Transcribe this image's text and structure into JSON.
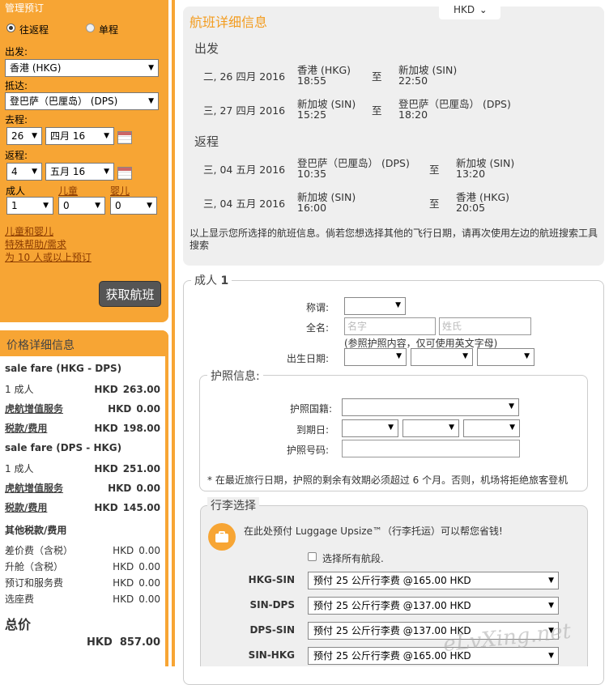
{
  "booking": {
    "header": "管理预订",
    "trip_roundtrip": "往返程",
    "trip_oneway": "单程",
    "from_label": "出发:",
    "from_value": "香港 (HKG)",
    "to_label": "抵达:",
    "to_value": "登巴萨（巴厘岛） (DPS)",
    "depart_label": "去程:",
    "depart_day": "26",
    "depart_month": "四月 16",
    "return_label": "返程:",
    "return_day": "4",
    "return_month": "五月 16",
    "adult_label": "成人",
    "child_label": "儿童",
    "infant_label": "婴儿",
    "adult_value": "1",
    "child_value": "0",
    "infant_value": "0",
    "links": [
      "儿童和婴儿",
      "特殊帮助/需求",
      "为 10 人或以上预订"
    ],
    "submit": "获取航班"
  },
  "price": {
    "header": "价格详细信息",
    "sections": [
      {
        "title": "sale fare (HKG - DPS)",
        "rows": [
          {
            "label": "1 成人",
            "currency": "HKD",
            "amount": "263.00",
            "link": false
          },
          {
            "label": "虎航增值服务",
            "currency": "HKD",
            "amount": "0.00",
            "link": true
          },
          {
            "label": "税款/费用",
            "currency": "HKD",
            "amount": "198.00",
            "link": true
          }
        ]
      },
      {
        "title": "sale fare (DPS - HKG)",
        "rows": [
          {
            "label": "1 成人",
            "currency": "HKD",
            "amount": "251.00",
            "link": false
          },
          {
            "label": "虎航增值服务",
            "currency": "HKD",
            "amount": "0.00",
            "link": true
          },
          {
            "label": "税款/费用",
            "currency": "HKD",
            "amount": "145.00",
            "link": true
          }
        ]
      }
    ],
    "other_title": "其他税款/费用",
    "other_rows": [
      {
        "label": "差价费（含税）",
        "currency": "HKD",
        "amount": "0.00"
      },
      {
        "label": "升舱（含税）",
        "currency": "HKD",
        "amount": "0.00"
      },
      {
        "label": "预订和服务费",
        "currency": "HKD",
        "amount": "0.00"
      },
      {
        "label": "选座费",
        "currency": "HKD",
        "amount": "0.00"
      }
    ],
    "total_label": "总价",
    "total_value": "HKD  857.00"
  },
  "currency_select": "HKD",
  "flights": {
    "title": "航班详细信息",
    "depart_heading": "出发",
    "return_heading": "返程",
    "to_word": "至",
    "depart": [
      {
        "date": "二, 26 四月 2016",
        "from": "香港 (HKG)",
        "from_time": "18:55",
        "to": "新加坡 (SIN)",
        "to_time": "22:50"
      },
      {
        "date": "三, 27 四月 2016",
        "from": "新加坡 (SIN)",
        "from_time": "15:25",
        "to": "登巴萨（巴厘岛） (DPS)",
        "to_time": "18:20"
      }
    ],
    "return": [
      {
        "date": "三, 04 五月 2016",
        "from": "登巴萨（巴厘岛） (DPS)",
        "from_time": "10:35",
        "to": "新加坡 (SIN)",
        "to_time": "13:20"
      },
      {
        "date": "三, 04 五月 2016",
        "from": "新加坡 (SIN)",
        "from_time": "16:00",
        "to": "香港 (HKG)",
        "to_time": "20:05"
      }
    ],
    "note": "以上显示您所选择的航班信息。倘若您想选择其他的飞行日期，请再次使用左边的航班搜索工具搜索"
  },
  "passenger": {
    "legend_prefix": "成人",
    "legend_num": "1",
    "title_label": "称谓:",
    "name_label": "全名:",
    "first_placeholder": "名字",
    "last_placeholder": "姓氏",
    "name_hint": "(参照护照内容，仅可使用英文字母)",
    "dob_label": "出生日期:",
    "passport_legend": "护照信息:",
    "nationality_label": "护照国籍:",
    "expiry_label": "到期日:",
    "number_label": "护照号码:",
    "passport_note": "* 在最近旅行日期，护照的剩余有效期必须超过 6 个月。否则，机场将拒绝旅客登机"
  },
  "baggage": {
    "legend": "行李选择",
    "promo": "在此处预付 Luggage Upsize™（行李托运）可以帮您省钱!",
    "select_all": "选择所有航段.",
    "segments": [
      {
        "label": "HKG-SIN",
        "option": "预付 25 公斤行李费 @165.00 HKD"
      },
      {
        "label": "SIN-DPS",
        "option": "预付 25 公斤行李费 @137.00 HKD"
      },
      {
        "label": "DPS-SIN",
        "option": "预付 25 公斤行李费 @137.00 HKD"
      },
      {
        "label": "SIN-HKG",
        "option": "预付 25 公斤行李费 @165.00 HKD"
      }
    ]
  },
  "watermark": "eLvXing.net"
}
